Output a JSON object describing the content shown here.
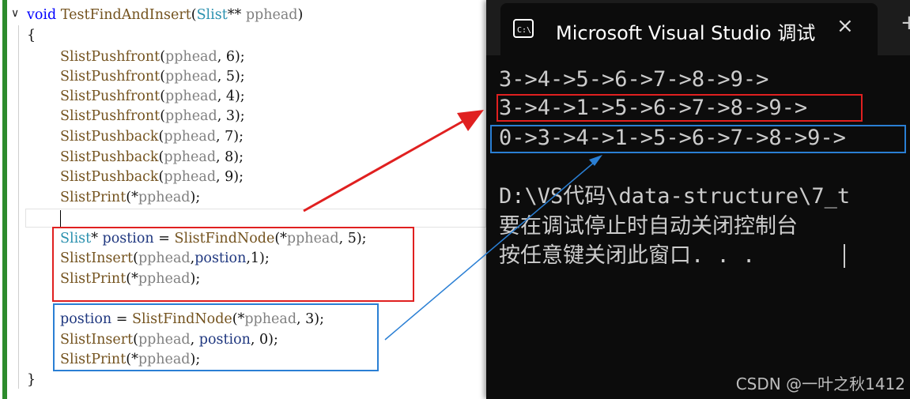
{
  "editor": {
    "fold_symbol": "∨",
    "lines": [
      [
        {
          "c": "kw",
          "t": "void "
        },
        {
          "c": "fn",
          "t": "TestFindAndInsert"
        },
        {
          "c": "pl",
          "t": "("
        },
        {
          "c": "ty",
          "t": "Slist"
        },
        {
          "c": "pl",
          "t": "** "
        },
        {
          "c": "pa",
          "t": "pphead"
        },
        {
          "c": "pl",
          "t": ")"
        }
      ],
      [
        {
          "c": "pl",
          "t": "{"
        }
      ],
      [
        {
          "c": "fn",
          "t": "SlistPushfront"
        },
        {
          "c": "pl",
          "t": "("
        },
        {
          "c": "pa",
          "t": "pphead"
        },
        {
          "c": "pl",
          "t": ", 6);"
        }
      ],
      [
        {
          "c": "fn",
          "t": "SlistPushfront"
        },
        {
          "c": "pl",
          "t": "("
        },
        {
          "c": "pa",
          "t": "pphead"
        },
        {
          "c": "pl",
          "t": ", 5);"
        }
      ],
      [
        {
          "c": "fn",
          "t": "SlistPushfront"
        },
        {
          "c": "pl",
          "t": "("
        },
        {
          "c": "pa",
          "t": "pphead"
        },
        {
          "c": "pl",
          "t": ", 4);"
        }
      ],
      [
        {
          "c": "fn",
          "t": "SlistPushfront"
        },
        {
          "c": "pl",
          "t": "("
        },
        {
          "c": "pa",
          "t": "pphead"
        },
        {
          "c": "pl",
          "t": ", 3);"
        }
      ],
      [
        {
          "c": "fn",
          "t": "SlistPushback"
        },
        {
          "c": "pl",
          "t": "("
        },
        {
          "c": "pa",
          "t": "pphead"
        },
        {
          "c": "pl",
          "t": ", 7);"
        }
      ],
      [
        {
          "c": "fn",
          "t": "SlistPushback"
        },
        {
          "c": "pl",
          "t": "("
        },
        {
          "c": "pa",
          "t": "pphead"
        },
        {
          "c": "pl",
          "t": ", 8);"
        }
      ],
      [
        {
          "c": "fn",
          "t": "SlistPushback"
        },
        {
          "c": "pl",
          "t": "("
        },
        {
          "c": "pa",
          "t": "pphead"
        },
        {
          "c": "pl",
          "t": ", 9);"
        }
      ],
      [
        {
          "c": "fn",
          "t": "SlistPrint"
        },
        {
          "c": "pl",
          "t": "(*"
        },
        {
          "c": "pa",
          "t": "pphead"
        },
        {
          "c": "pl",
          "t": ");"
        }
      ],
      [],
      [
        {
          "c": "ty",
          "t": "Slist"
        },
        {
          "c": "pl",
          "t": "* "
        },
        {
          "c": "vr",
          "t": "postion"
        },
        {
          "c": "pl",
          "t": " = "
        },
        {
          "c": "fn",
          "t": "SlistFindNode"
        },
        {
          "c": "pl",
          "t": "(*"
        },
        {
          "c": "pa",
          "t": "pphead"
        },
        {
          "c": "pl",
          "t": ", 5);"
        }
      ],
      [
        {
          "c": "fn",
          "t": "SlistInsert"
        },
        {
          "c": "pl",
          "t": "("
        },
        {
          "c": "pa",
          "t": "pphead"
        },
        {
          "c": "pl",
          "t": ","
        },
        {
          "c": "vr",
          "t": "postion"
        },
        {
          "c": "pl",
          "t": ",1);"
        }
      ],
      [
        {
          "c": "fn",
          "t": "SlistPrint"
        },
        {
          "c": "pl",
          "t": "(*"
        },
        {
          "c": "pa",
          "t": "pphead"
        },
        {
          "c": "pl",
          "t": ");"
        }
      ],
      [],
      [
        {
          "c": "vr",
          "t": "postion"
        },
        {
          "c": "pl",
          "t": " = "
        },
        {
          "c": "fn",
          "t": "SlistFindNode"
        },
        {
          "c": "pl",
          "t": "(*"
        },
        {
          "c": "pa",
          "t": "pphead"
        },
        {
          "c": "pl",
          "t": ", 3);"
        }
      ],
      [
        {
          "c": "fn",
          "t": "SlistInsert"
        },
        {
          "c": "pl",
          "t": "("
        },
        {
          "c": "pa",
          "t": "pphead"
        },
        {
          "c": "pl",
          "t": ", "
        },
        {
          "c": "vr",
          "t": "postion"
        },
        {
          "c": "pl",
          "t": ", 0);"
        }
      ],
      [
        {
          "c": "fn",
          "t": "SlistPrint"
        },
        {
          "c": "pl",
          "t": "(*"
        },
        {
          "c": "pa",
          "t": "pphead"
        },
        {
          "c": "pl",
          "t": ");"
        }
      ],
      [
        {
          "c": "pl",
          "t": "}"
        }
      ]
    ]
  },
  "console": {
    "title": "Microsoft Visual Studio 调试",
    "close_label": "×",
    "new_tab_label": "+",
    "output": [
      "3->4->5->6->7->8->9->",
      "3->4->1->5->6->7->8->9->",
      "0->3->4->1->5->6->7->8->9->",
      "",
      "D:\\VS代码\\data-structure\\7_t",
      "要在调试停止时自动关闭控制台",
      "按任意键关闭此窗口. . ."
    ]
  },
  "watermark": "CSDN @一叶之秋1412",
  "colors": {
    "highlight_red": "#e02020",
    "highlight_blue": "#2a7fd4",
    "console_bg": "#0c0c0c"
  }
}
